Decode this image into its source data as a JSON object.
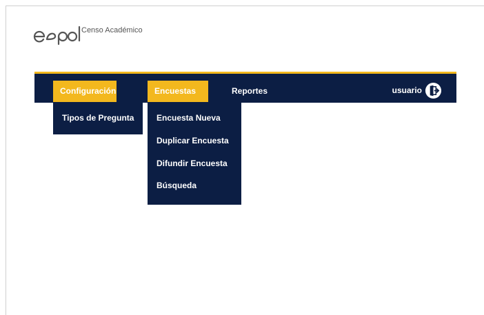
{
  "brand": {
    "logo_text": "espol",
    "subtitle": "Censo Académico"
  },
  "navbar": {
    "items": [
      {
        "label": "Configuración",
        "active": true
      },
      {
        "label": "Encuestas",
        "active": true
      },
      {
        "label": "Reportes",
        "active": false
      }
    ],
    "user_label": "usuario",
    "user_icon": "logout-icon"
  },
  "menus": {
    "configuracion": [
      "Tipos de Pregunta"
    ],
    "encuestas": [
      "Encuesta Nueva",
      "Duplicar Encuesta",
      "Difundir Encuesta",
      "Búsqueda"
    ]
  },
  "colors": {
    "navbar_bg": "#0c1e44",
    "accent": "#f3b81e",
    "text_light": "#ffffff"
  }
}
